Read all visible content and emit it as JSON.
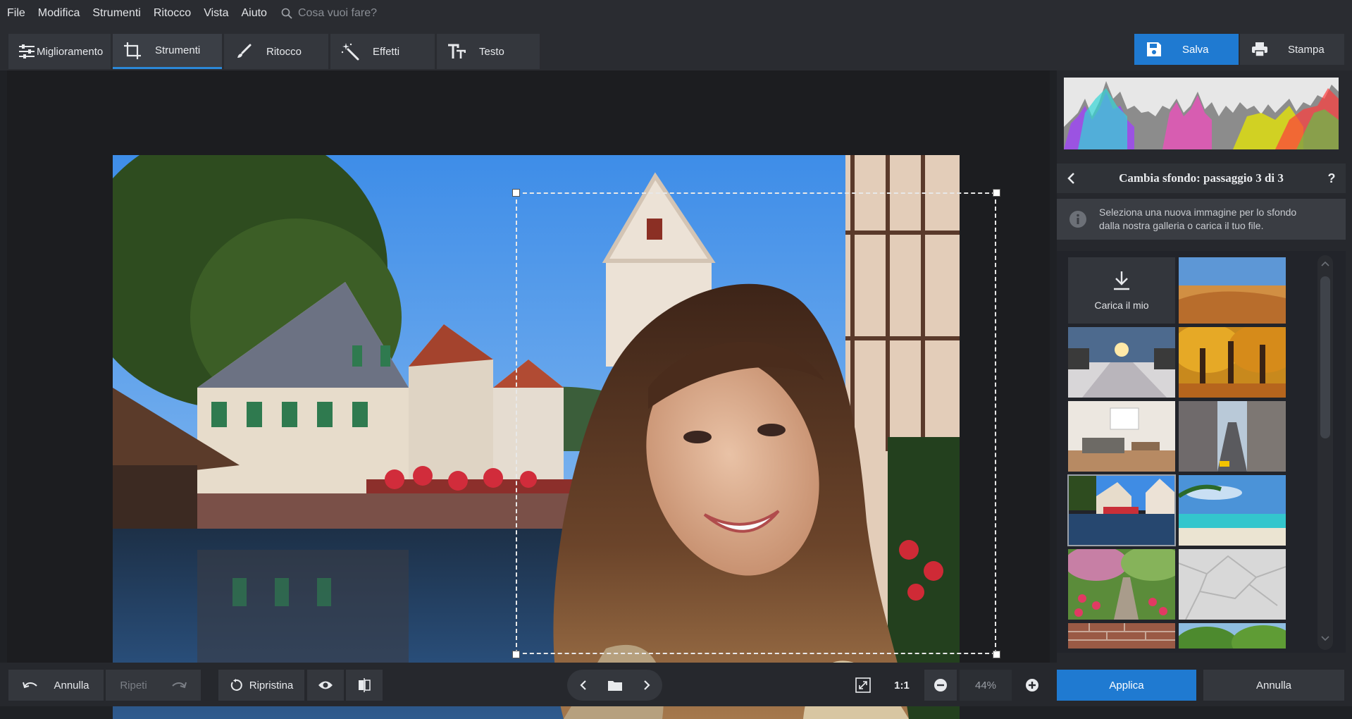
{
  "menu": {
    "items": [
      "File",
      "Modifica",
      "Strumenti",
      "Ritocco",
      "Vista",
      "Aiuto"
    ],
    "search_placeholder": "Cosa vuoi fare?"
  },
  "tabs": [
    {
      "label": "Miglioramento",
      "icon": "sliders-icon"
    },
    {
      "label": "Strumenti",
      "icon": "crop-icon",
      "active": true
    },
    {
      "label": "Ritocco",
      "icon": "brush-icon"
    },
    {
      "label": "Effetti",
      "icon": "magic-wand-icon"
    },
    {
      "label": "Testo",
      "icon": "text-icon"
    }
  ],
  "actions": {
    "save_label": "Salva",
    "print_label": "Stampa"
  },
  "panel": {
    "step_title": "Cambia sfondo: passaggio 3 di 3",
    "help_label": "?",
    "info_text_1": "Seleziona una nuova immagine per lo sfondo",
    "info_text_2": "dalla nostra galleria o carica il tuo file.",
    "upload_label": "Carica il mio",
    "gallery": [
      "desert",
      "winter-road",
      "autumn-forest",
      "living-room",
      "city-street",
      "canal-town",
      "tropical-beach",
      "tulip-garden",
      "crumpled-paper",
      "brick-wall",
      "green-trees"
    ],
    "selected_background": "canal-town"
  },
  "bottom": {
    "undo_label": "Annulla",
    "redo_label": "Ripeti",
    "reset_label": "Ripristina",
    "one_to_one": "1:1",
    "zoom": "44%",
    "apply_label": "Applica",
    "cancel_label": "Annulla"
  },
  "colors": {
    "accent": "#1f7ad1",
    "bg": "#1f2125"
  }
}
